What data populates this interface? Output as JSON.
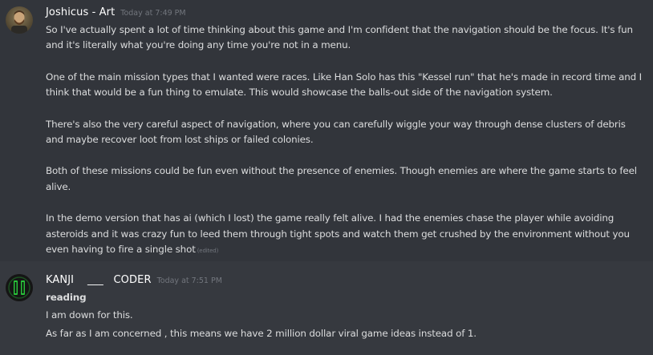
{
  "messages": [
    {
      "username": "Joshicus - Art",
      "username_color": "#ffffff",
      "avatar_icon": "avatar-portrait",
      "timestamp": "Today at 7:49 PM",
      "paragraphs": [
        [
          "So I've actually spent a lot of time thinking about this game and I'm confident that the navigation should be the focus. It's fun",
          "and it's literally what you're doing any time you're not in a menu."
        ],
        [
          "One of the main mission types that I wanted were races. Like Han Solo has this \"Kessel run\" that he's made in record time and I",
          "think that would be a fun thing to emulate. This would showcase the balls-out side of the navigation system."
        ],
        [
          "There's also the very careful aspect of navigation, where you can carefully wiggle your way through dense clusters of debris",
          "and maybe recover loot from lost ships or failed colonies."
        ],
        [
          "Both of these missions could be fun even without the presence of enemies. Though enemies are where the game starts to feel",
          "alive."
        ],
        [
          "In the demo version that has ai (which I lost) the game really felt alive. I had the enemies chase the player while avoiding",
          "asteroids and it was crazy fun to leed them through tight spots and watch them get crushed by the environment without you",
          "even having to fire a single shot"
        ]
      ],
      "edited_label": "(edited)"
    },
    {
      "username": "KANJI    ___   CODER",
      "username_color": "#ffffff",
      "avatar_icon": "avatar-pause-logo",
      "avatar_accent": "#29c43a",
      "timestamp": "Today at 7:51 PM",
      "lines": [
        "reading",
        "I am down for this.",
        "As far as I am concerned , this means we have 2 million dollar viral game ideas instead of 1."
      ]
    }
  ]
}
